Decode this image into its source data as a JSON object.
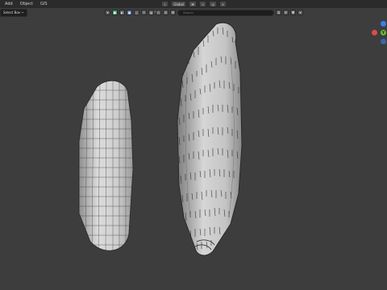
{
  "menu": {
    "items": [
      "Add",
      "Object",
      "GIS"
    ]
  },
  "header": {
    "select_box": "Select Box ~"
  },
  "top_tools": {
    "orientation": "Global"
  },
  "viewport_toolbar": {
    "search_placeholder": "Search"
  },
  "gizmo": {
    "x_color": "#e14a4a",
    "y_color": "#6aba3d",
    "z_color": "#3b7ce8",
    "y_label": "Y"
  },
  "colors": {
    "viewport_bg": "#3d3d3d",
    "mesh_fill": "#cfcfcf",
    "wire": "#3a3a3a",
    "accent": "#4772b3"
  }
}
